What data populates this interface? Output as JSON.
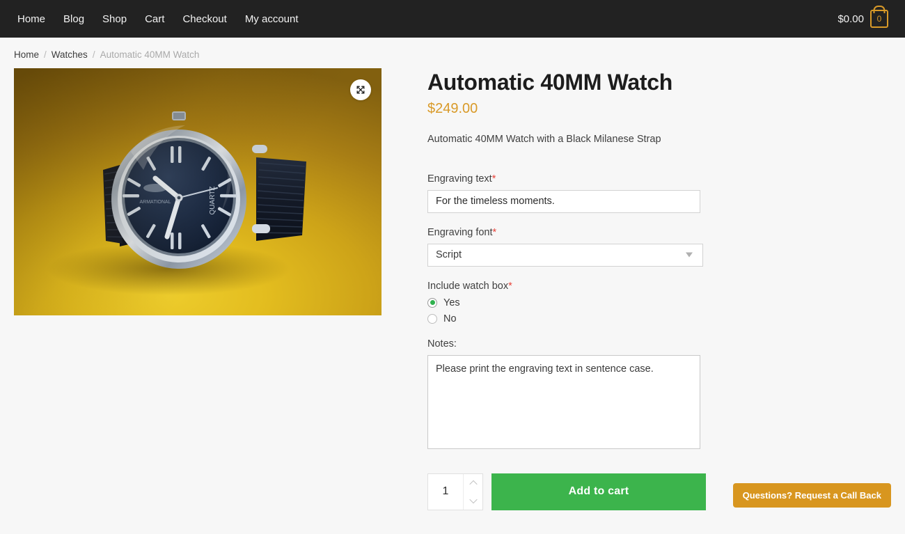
{
  "header": {
    "nav": [
      {
        "label": "Home"
      },
      {
        "label": "Blog"
      },
      {
        "label": "Shop"
      },
      {
        "label": "Cart"
      },
      {
        "label": "Checkout"
      },
      {
        "label": "My account"
      }
    ],
    "cart": {
      "total": "$0.00",
      "count": "0",
      "icon": "shopping-bag-icon",
      "accent_color": "#d99a28"
    },
    "background_color": "#222222"
  },
  "breadcrumb": {
    "items": [
      {
        "label": "Home",
        "current": false
      },
      {
        "label": "Watches",
        "current": false
      },
      {
        "label": "Automatic 40MM Watch",
        "current": true
      }
    ],
    "separator": "/"
  },
  "gallery": {
    "expand_icon": "expand-arrows-icon",
    "image_alt": "Automatic 40MM Watch on yellow background",
    "background_color": "#e3bd1f"
  },
  "product": {
    "title": "Automatic 40MM Watch",
    "price": "$249.00",
    "price_color": "#d99a28",
    "description": "Automatic 40MM Watch with a Black Milanese Strap"
  },
  "form": {
    "engraving_text": {
      "label": "Engraving text",
      "required_marker": "*",
      "value": "For the timeless moments.",
      "placeholder": ""
    },
    "engraving_font": {
      "label": "Engraving font",
      "required_marker": "*",
      "value": "Script",
      "options": [
        "Script"
      ]
    },
    "watch_box": {
      "label": "Include watch box",
      "required_marker": "*",
      "selected": "Yes",
      "options": [
        {
          "label": "Yes",
          "checked": true
        },
        {
          "label": "No",
          "checked": false
        }
      ],
      "checked_color": "#30b14e"
    },
    "notes": {
      "label": "Notes:",
      "value": "Please print the engraving text in sentence case.",
      "placeholder": ""
    },
    "required_color": "#e8443a"
  },
  "purchase": {
    "quantity": "1",
    "increment_icon": "chevron-up-icon",
    "decrement_icon": "chevron-down-icon",
    "add_to_cart_label": "Add to cart",
    "add_to_cart_color": "#3cb44c"
  },
  "callback": {
    "label": "Questions? Request a Call Back",
    "color": "#d8961f"
  }
}
